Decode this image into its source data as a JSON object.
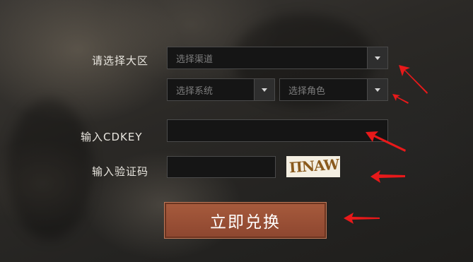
{
  "form": {
    "region_label": "请选择大区",
    "channel_placeholder": "选择渠道",
    "system_placeholder": "选择系统",
    "role_placeholder": "选择角色",
    "cdkey_label": "输入CDKEY",
    "cdkey_value": "",
    "captcha_label": "输入验证码",
    "captcha_value": "",
    "captcha_image_text": "ПNAW",
    "submit_label": "立即兑换"
  },
  "colors": {
    "submit_button": "#9b5237",
    "annotation_arrows": "#e8191a"
  },
  "icons": {
    "dropdown": "chevron-down-icon"
  }
}
